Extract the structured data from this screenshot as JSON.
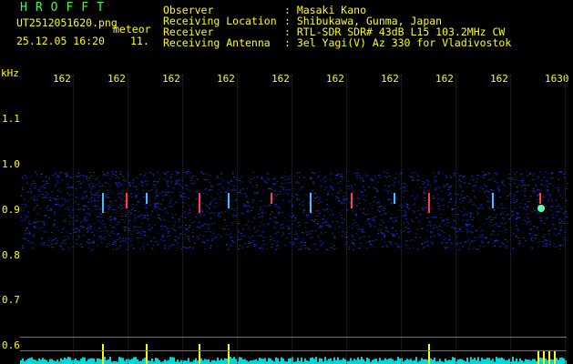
{
  "logo": "HROFFT",
  "file": {
    "name": "UT2512051620.png",
    "meteor_label": "meteor",
    "datetime": "25.12.05 16:20",
    "count": "11."
  },
  "info": {
    "observer_label": "Observer",
    "observer_value": ": Masaki Kano",
    "location_label": "Receiving Location",
    "location_value": ": Shibukawa, Gunma, Japan",
    "receiver_label": "Receiver",
    "receiver_value": ": RTL-SDR SDR# 43dB L15 103.2MHz CW",
    "antenna_label": "Receiving Antenna",
    "antenna_value": ": 3el Yagi(V) Az 330 for Vladivostok"
  },
  "axis": {
    "unit": "kHz",
    "time_ticks": [
      "162",
      "162",
      "162",
      "162",
      "162",
      "162",
      "162",
      "162",
      "162",
      "1630"
    ],
    "freq_ticks": [
      "1.1",
      "1.0",
      "0.9",
      "0.8",
      "0.7",
      "0.6"
    ]
  },
  "colors": {
    "text": "#ffff00",
    "logo": "#3cff3c",
    "noise": "#1a2cff",
    "trace": "#00ffff"
  }
}
